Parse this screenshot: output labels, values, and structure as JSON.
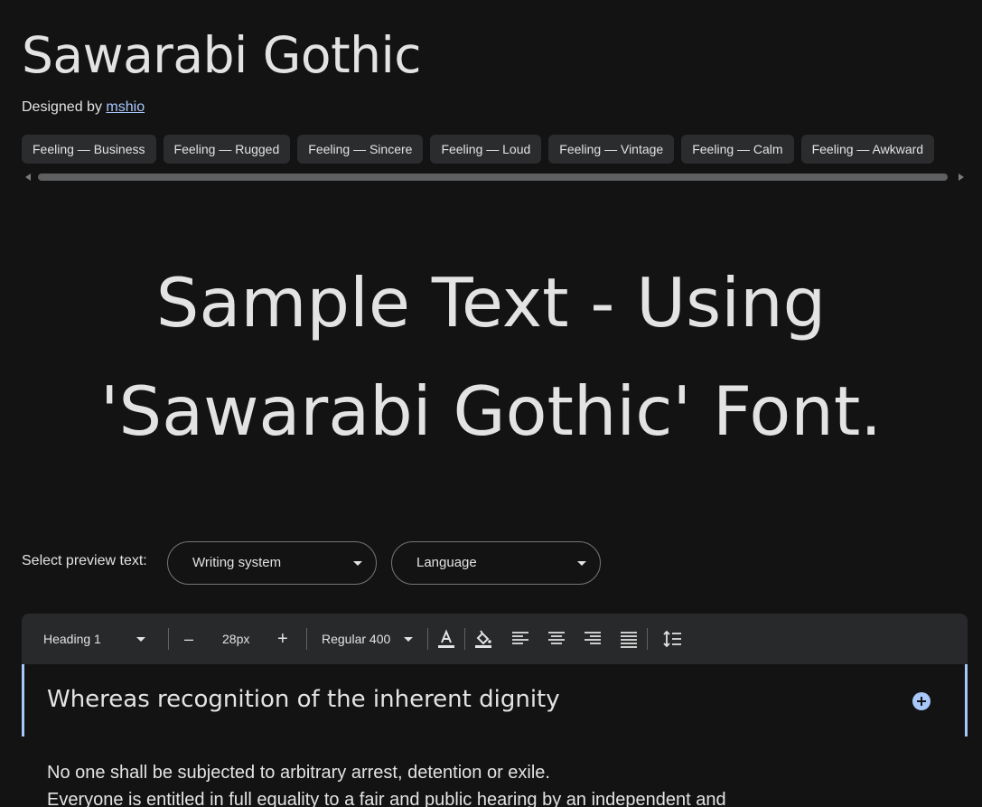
{
  "font": {
    "title": "Sawarabi Gothic",
    "designed_by_label": "Designed by",
    "designer": "mshio"
  },
  "tags": [
    "Feeling — Business",
    "Feeling — Rugged",
    "Feeling — Sincere",
    "Feeling — Loud",
    "Feeling — Vintage",
    "Feeling — Calm",
    "Feeling — Awkward"
  ],
  "sample_text": "Sample Text - Using 'Sawarabi Gothic' Font.",
  "preview": {
    "label": "Select preview text:",
    "writing_system": "Writing system",
    "language": "Language"
  },
  "toolbar": {
    "style": "Heading 1",
    "size": "28px",
    "weight": "Regular 400",
    "decrease_label": "–",
    "increase_label": "+"
  },
  "editor": {
    "heading": "Whereas recognition of the inherent dignity",
    "body_line_1": "No one shall be subjected to arbitrary arrest, detention or exile.",
    "body_line_2": "Everyone is entitled in full equality to a fair and public hearing by an independent and"
  },
  "colors": {
    "background": "#131314",
    "link": "#a8c7fa",
    "accent": "#a8c7fa",
    "chip": "#2b2c2e",
    "toolbar": "#28292a"
  }
}
